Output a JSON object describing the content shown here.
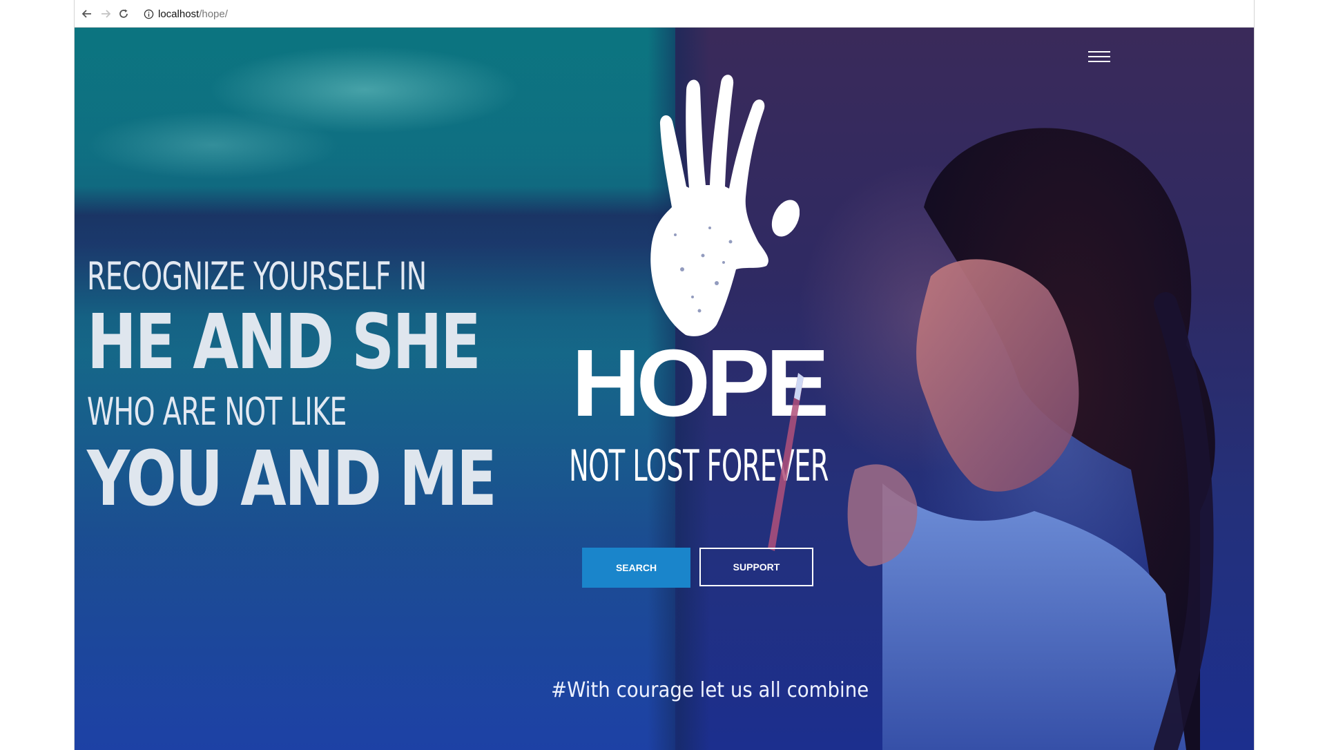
{
  "browser": {
    "url_host": "localhost",
    "url_path": "/hope/"
  },
  "hero": {
    "tagline": {
      "line1": "RECOGNIZE YOURSELF IN",
      "line2": "HE AND SHE",
      "line3": "WHO ARE NOT LIKE",
      "line4": "YOU AND ME"
    },
    "logo": {
      "title": "HOPE",
      "subtitle": "NOT LOST FOREVER"
    },
    "buttons": {
      "search_label": "SEARCH",
      "support_label": "SUPPORT"
    },
    "hashtag": "#With courage let us all combine"
  },
  "icons": {
    "back": "arrow-left-icon",
    "forward": "arrow-right-icon",
    "reload": "reload-icon",
    "site_info": "info-icon",
    "menu": "hamburger-menu-icon",
    "logo": "handprint-icon"
  },
  "colors": {
    "accent_button": "#1a85cb",
    "text_light": "#ffffff"
  }
}
